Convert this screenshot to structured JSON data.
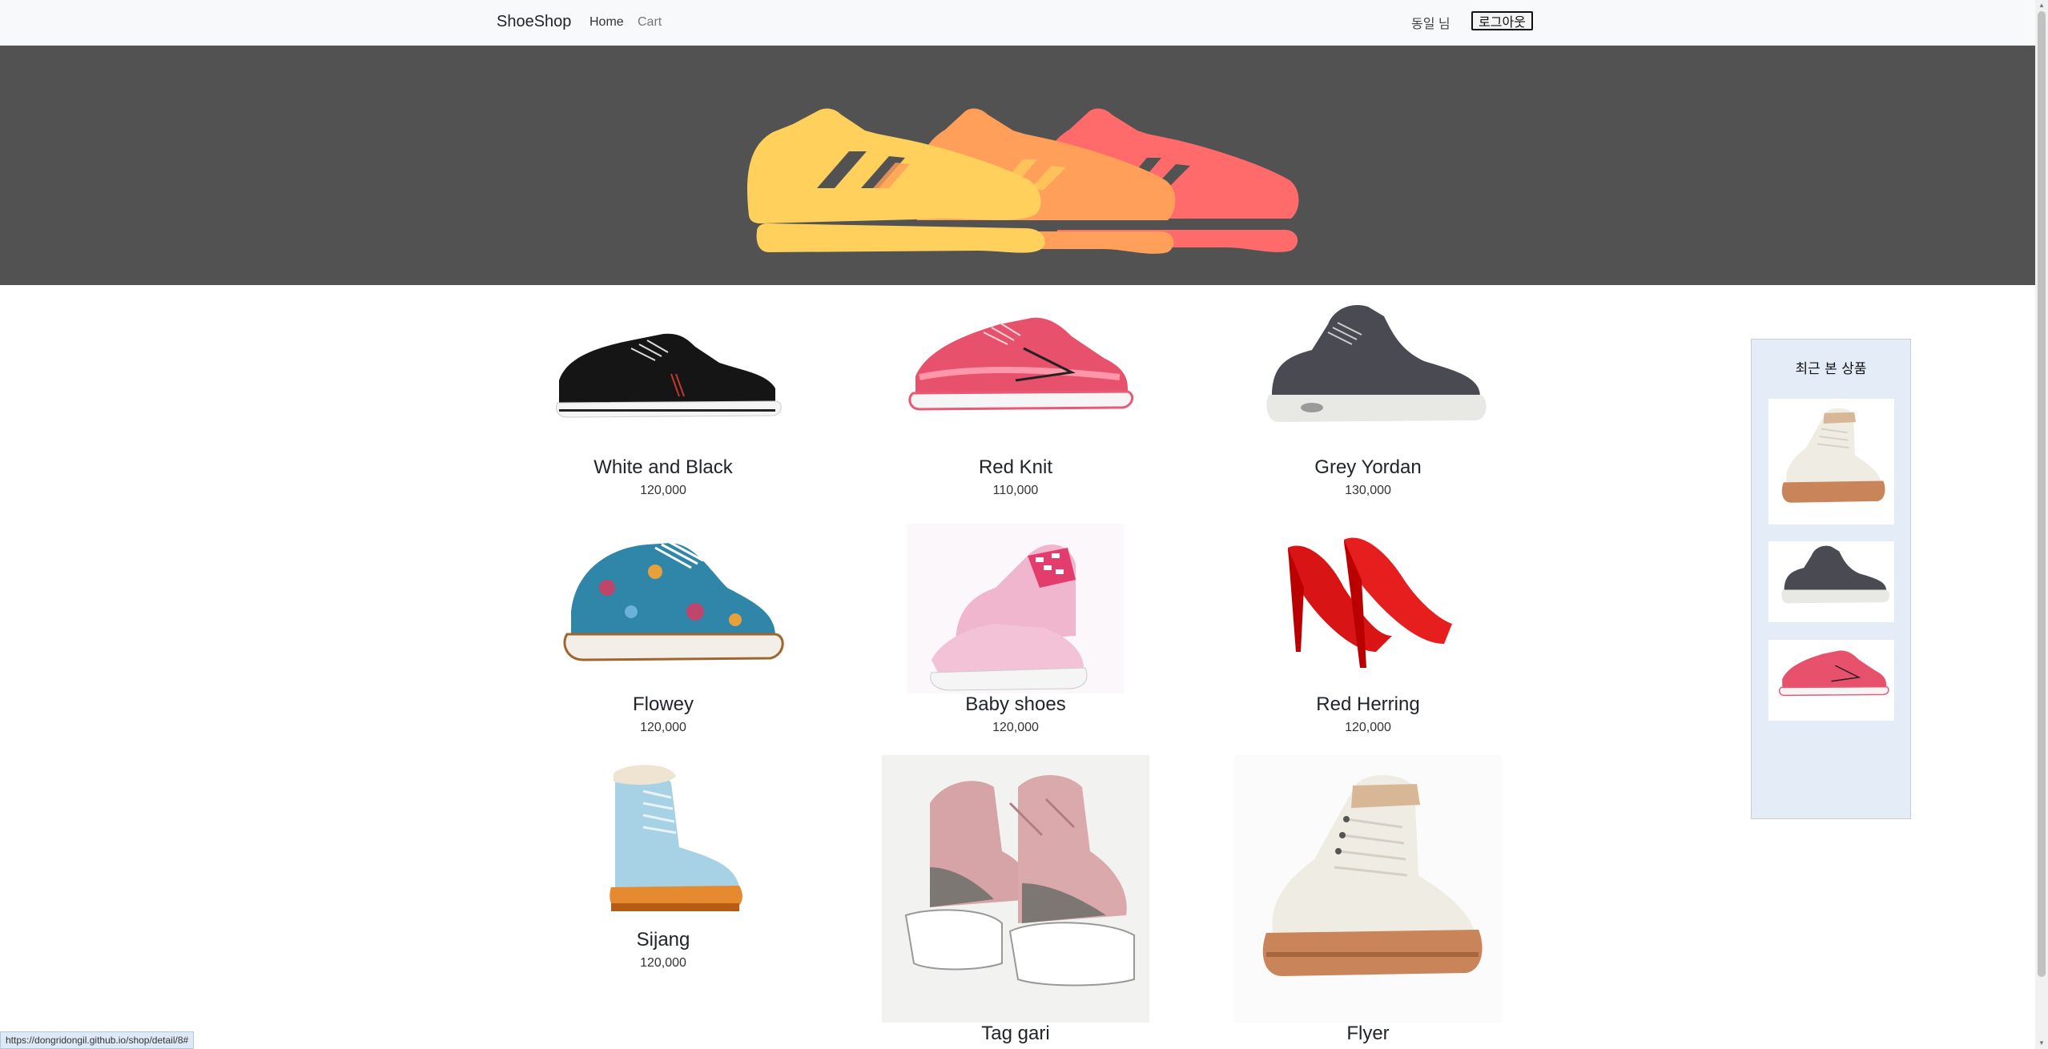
{
  "nav": {
    "brand": "ShoeShop",
    "links": [
      {
        "label": "Home"
      },
      {
        "label": "Cart"
      }
    ],
    "user": "동일 님",
    "logout": "로그아웃"
  },
  "products": [
    {
      "name": "White and Black",
      "price": "120,000"
    },
    {
      "name": "Red Knit",
      "price": "110,000"
    },
    {
      "name": "Grey Yordan",
      "price": "130,000"
    },
    {
      "name": "Flowey",
      "price": "120,000"
    },
    {
      "name": "Baby shoes",
      "price": "120,000"
    },
    {
      "name": "Red Herring",
      "price": "120,000"
    },
    {
      "name": "Sijang",
      "price": "120,000"
    },
    {
      "name": "Tag gari",
      "price": ""
    },
    {
      "name": "Flyer",
      "price": ""
    }
  ],
  "recent": {
    "title": "최근 본 상품"
  },
  "status_url": "https://dongridongil.github.io/shop/detail/8#",
  "colors": {
    "hero_bg": "#525252",
    "shoe_yellow": "#ffd15c",
    "shoe_orange": "#ff9f59",
    "shoe_coral": "#ff6b6b",
    "recent_bg": "#e3ecf7"
  }
}
